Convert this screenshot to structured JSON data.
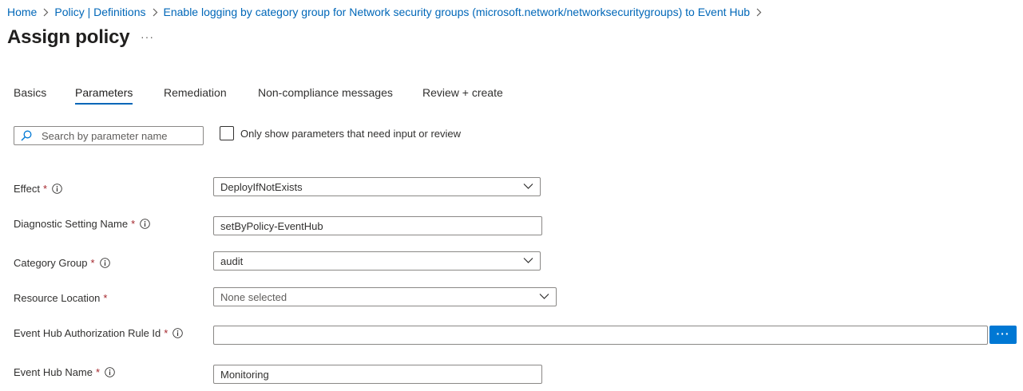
{
  "breadcrumb": [
    {
      "label": "Home"
    },
    {
      "label": "Policy | Definitions"
    },
    {
      "label": "Enable logging by category group for Network security groups (microsoft.network/networksecuritygroups) to Event Hub"
    }
  ],
  "page": {
    "title": "Assign policy",
    "more": "···"
  },
  "tabs": [
    {
      "label": "Basics",
      "active": false
    },
    {
      "label": "Parameters",
      "active": true
    },
    {
      "label": "Remediation",
      "active": false
    },
    {
      "label": "Non-compliance messages",
      "active": false
    },
    {
      "label": "Review + create",
      "active": false
    }
  ],
  "filter": {
    "search_placeholder": "Search by parameter name",
    "checkbox_label": "Only show parameters that need input or review",
    "checkbox_checked": false
  },
  "fields": {
    "effect": {
      "label": "Effect",
      "value": "DeployIfNotExists"
    },
    "diagnostic_setting_name": {
      "label": "Diagnostic Setting Name",
      "value": "setByPolicy-EventHub"
    },
    "category_group": {
      "label": "Category Group",
      "value": "audit"
    },
    "resource_location": {
      "label": "Resource Location",
      "placeholder": "None selected"
    },
    "event_hub_rule_id": {
      "label": "Event Hub Authorization Rule Id",
      "value": ""
    },
    "event_hub_name": {
      "label": "Event Hub Name",
      "value": "Monitoring"
    }
  },
  "required_marker": "*",
  "browse_button": "···",
  "icons": {
    "breadcrumb_separator": "chevron-right-icon",
    "search": "search-icon",
    "info": "info-icon",
    "dropdown": "chevron-down-icon"
  },
  "colors": {
    "link": "#0067b8",
    "accent": "#0078d4",
    "required": "#a4262c",
    "text": "#323130",
    "border": "#8a8886"
  }
}
